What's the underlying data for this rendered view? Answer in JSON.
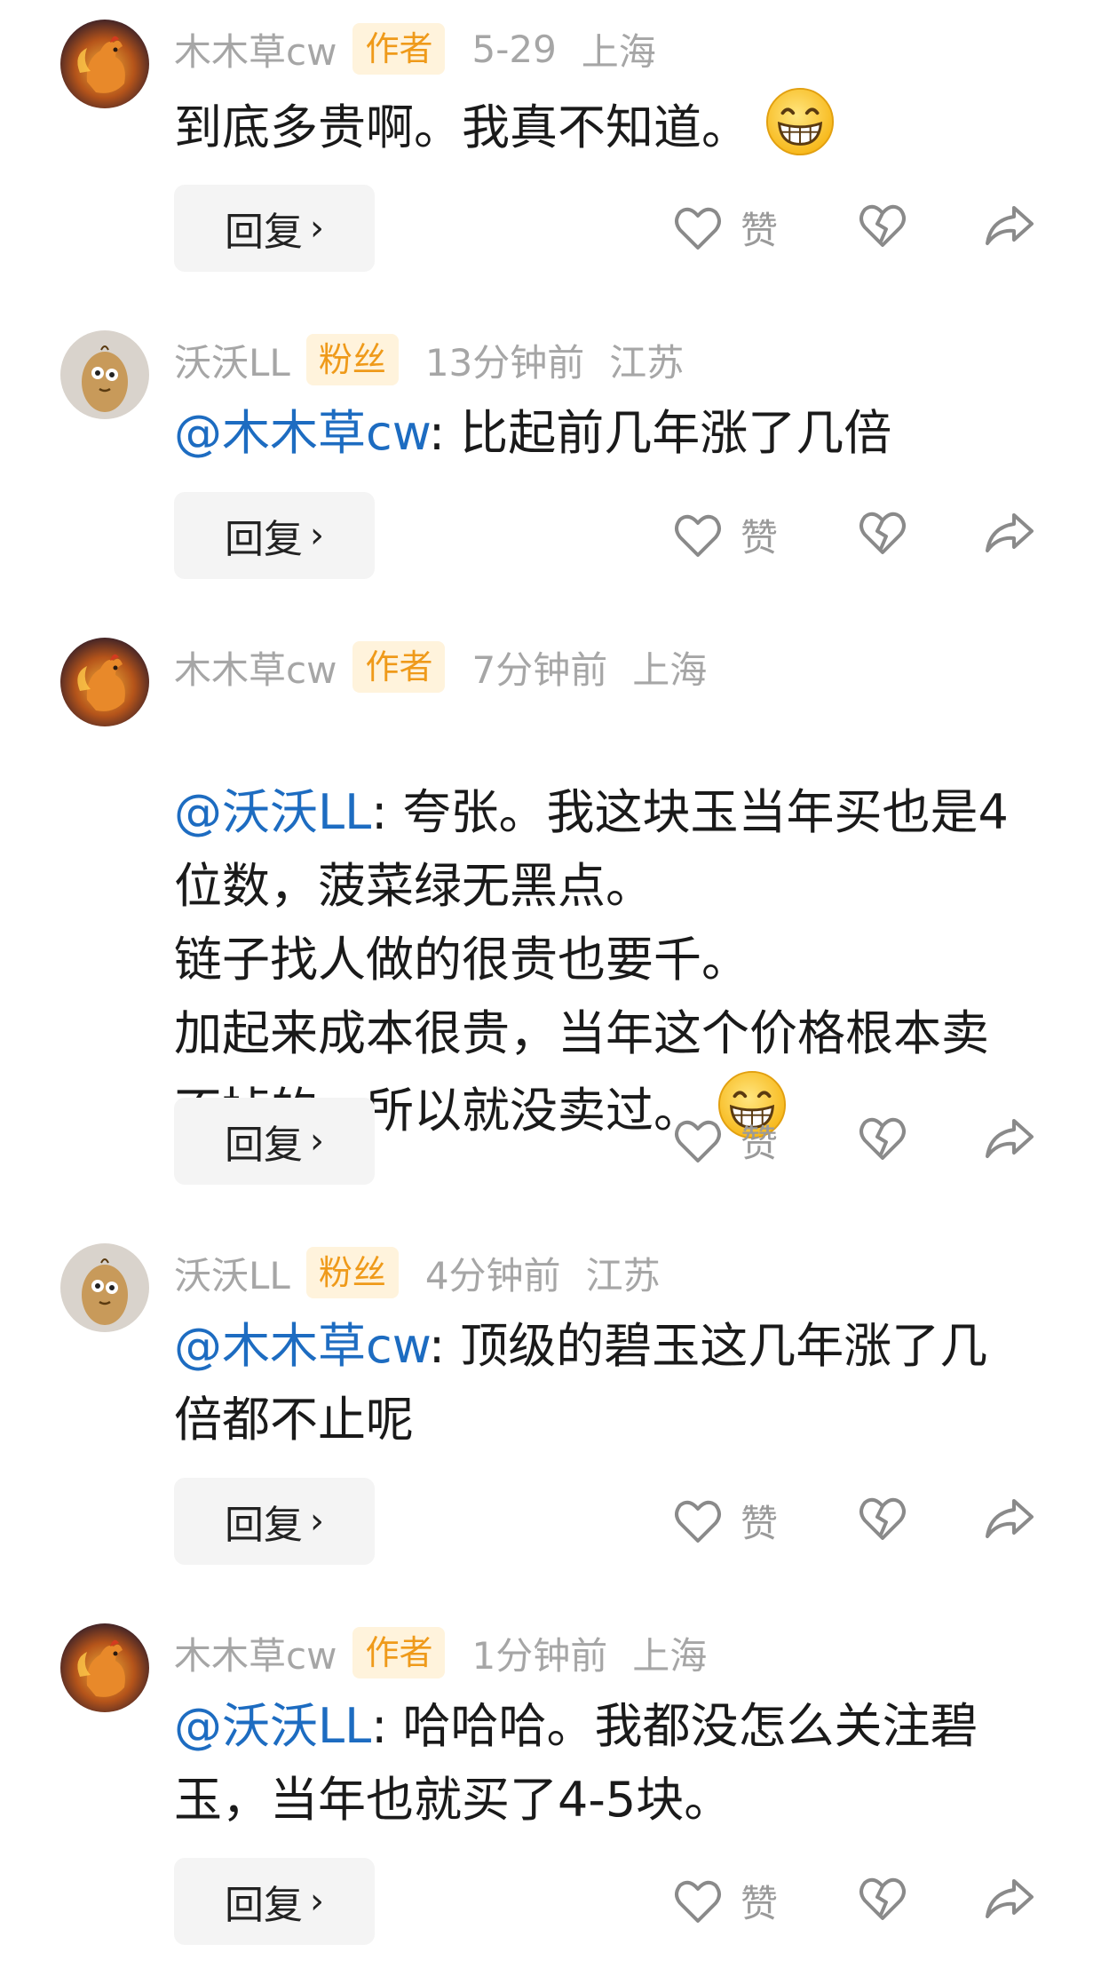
{
  "comments": [
    {
      "user": "木木草cw",
      "badge": "作者",
      "time": "5-29",
      "location": "上海",
      "mention": "",
      "text": "到底多贵啊。我真不知道。",
      "emoji": true,
      "reply_label": "回复",
      "like_label": "赞",
      "avatar": "rooster"
    },
    {
      "user": "沃沃LL",
      "badge": "粉丝",
      "time": "13分钟前",
      "location": "江苏",
      "mention": "@木木草cw",
      "text": ": 比起前几年涨了几倍",
      "emoji": false,
      "reply_label": "回复",
      "like_label": "赞",
      "avatar": "potato"
    },
    {
      "user": "木木草cw",
      "badge": "作者",
      "time": "7分钟前",
      "location": "上海",
      "mention": "@沃沃LL",
      "text": ": 夸张。我这块玉当年买也是4位数，菠菜绿无黑点。\n链子找人做的很贵也要千。\n加起来成本很贵，当年这个价格根本卖不掉的，所以就没卖过。",
      "emoji": true,
      "reply_label": "回复",
      "like_label": "赞",
      "avatar": "rooster"
    },
    {
      "user": "沃沃LL",
      "badge": "粉丝",
      "time": "4分钟前",
      "location": "江苏",
      "mention": "@木木草cw",
      "text": ": 顶级的碧玉这几年涨了几倍都不止呢",
      "emoji": false,
      "reply_label": "回复",
      "like_label": "赞",
      "avatar": "potato"
    },
    {
      "user": "木木草cw",
      "badge": "作者",
      "time": "1分钟前",
      "location": "上海",
      "mention": "@沃沃LL",
      "text": ": 哈哈哈。我都没怎么关注碧玉，当年也就买了4-5块。",
      "emoji": false,
      "reply_label": "回复",
      "like_label": "赞",
      "avatar": "rooster"
    }
  ],
  "colors": {
    "mention": "#1d6cc1",
    "badge_bg": "#fff3dc",
    "badge_text": "#ef9a1a",
    "meta": "#a6a6a6"
  },
  "icons": [
    "heart-outline-icon",
    "broken-heart-icon",
    "share-arrow-icon",
    "chevron-right-icon",
    "grin-emoji-icon"
  ]
}
